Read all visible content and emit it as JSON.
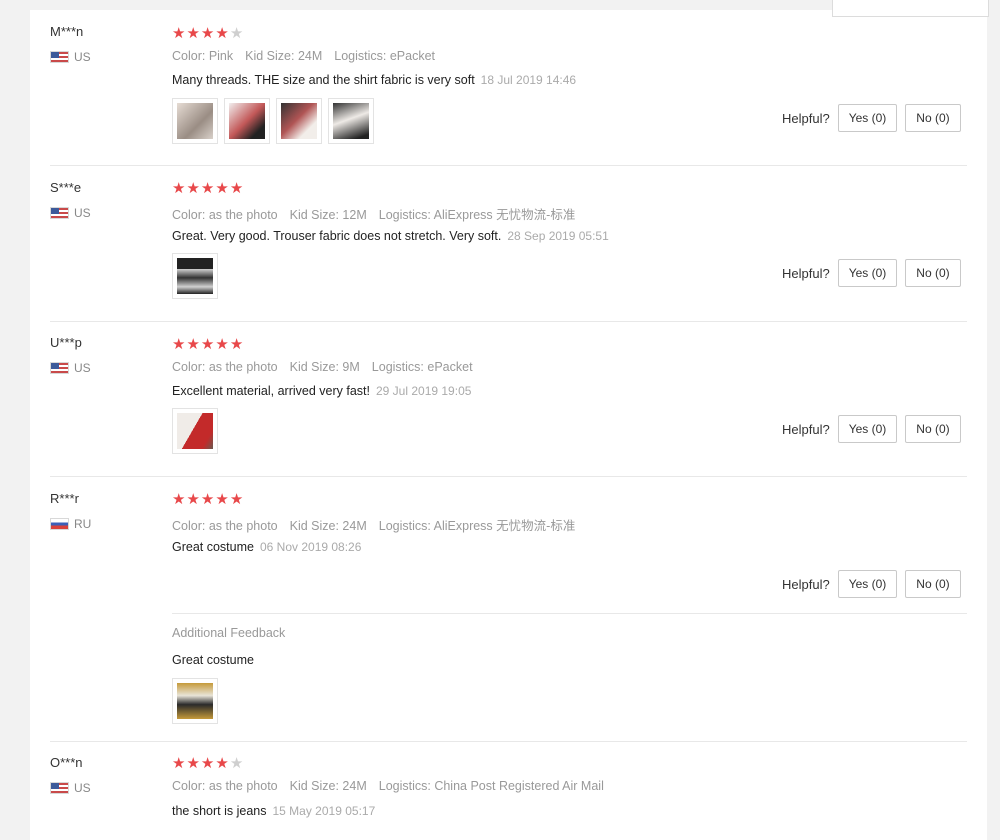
{
  "reviews": [
    {
      "user": "M***n",
      "country": "US",
      "stars": 4,
      "color": "Color: Pink",
      "size": "Kid Size: 24M",
      "logistics": "Logistics: ePacket",
      "text": "Many threads. THE size and the shirt fabric is very soft",
      "date": "18 Jul 2019 14:46",
      "photos": 4
    },
    {
      "user": "S***e",
      "country": "US",
      "stars": 5,
      "color": "Color: as the photo",
      "size": "Kid Size: 12M",
      "logistics": "Logistics: AliExpress 无忧物流-标准",
      "text": "Great. Very good. Trouser fabric does not stretch. Very soft.",
      "date": "28 Sep 2019 05:51",
      "photos": 1
    },
    {
      "user": "U***p",
      "country": "US",
      "stars": 5,
      "color": "Color: as the photo",
      "size": "Kid Size: 9M",
      "logistics": "Logistics: ePacket",
      "text": "Excellent material, arrived very fast!",
      "date": "29 Jul 2019 19:05",
      "photos": 1
    },
    {
      "user": "R***r",
      "country": "RU",
      "stars": 5,
      "color": "Color: as the photo",
      "size": "Kid Size: 24M",
      "logistics": "Logistics: AliExpress 无忧物流-标准",
      "text": "Great costume",
      "date": "06 Nov 2019 08:26",
      "photos": 0,
      "additional_label": "Additional Feedback",
      "additional_text": "Great costume",
      "additional_photos": 1
    },
    {
      "user": "O***n",
      "country": "US",
      "stars": 4,
      "color": "Color: as the photo",
      "size": "Kid Size: 24M",
      "logistics": "Logistics: China Post Registered Air Mail",
      "text": "the short is jeans",
      "date": "15 May 2019 05:17",
      "photos": 0
    }
  ],
  "helpful": {
    "label": "Helpful?",
    "yes": "Yes (0)",
    "no": "No (0)"
  },
  "colors": {
    "star": "#e8484a",
    "star_empty": "#cfcfcf"
  }
}
